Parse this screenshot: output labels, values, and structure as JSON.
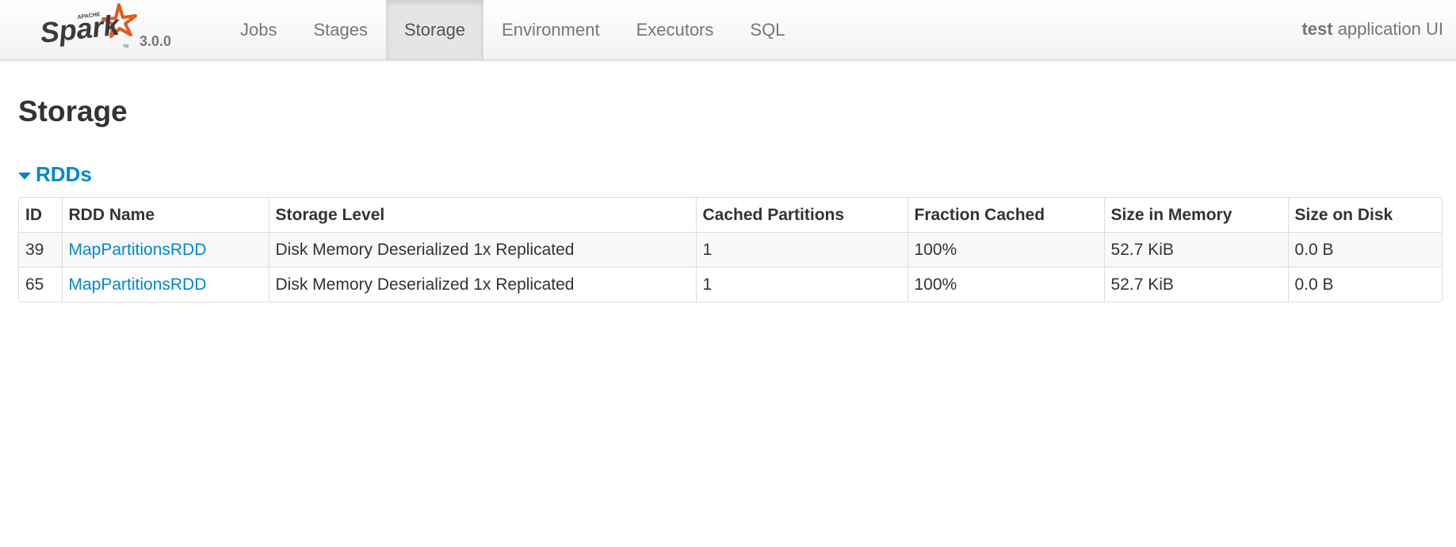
{
  "app": {
    "version": "3.0.0",
    "app_name_bold": "test",
    "app_name_rest": " application UI"
  },
  "nav": {
    "items": [
      {
        "label": "Jobs",
        "active": false
      },
      {
        "label": "Stages",
        "active": false
      },
      {
        "label": "Storage",
        "active": true
      },
      {
        "label": "Environment",
        "active": false
      },
      {
        "label": "Executors",
        "active": false
      },
      {
        "label": "SQL",
        "active": false
      }
    ]
  },
  "page": {
    "title": "Storage"
  },
  "rdds": {
    "section_label": "RDDs",
    "columns": [
      "ID",
      "RDD Name",
      "Storage Level",
      "Cached Partitions",
      "Fraction Cached",
      "Size in Memory",
      "Size on Disk"
    ],
    "rows": [
      {
        "id": "39",
        "name": "MapPartitionsRDD",
        "storage_level": "Disk Memory Deserialized 1x Replicated",
        "cached_partitions": "1",
        "fraction_cached": "100%",
        "size_in_memory": "52.7 KiB",
        "size_on_disk": "0.0 B"
      },
      {
        "id": "65",
        "name": "MapPartitionsRDD",
        "storage_level": "Disk Memory Deserialized 1x Replicated",
        "cached_partitions": "1",
        "fraction_cached": "100%",
        "size_in_memory": "52.7 KiB",
        "size_on_disk": "0.0 B"
      }
    ]
  },
  "colors": {
    "link": "#0088cc",
    "spark_orange": "#e25a1c",
    "spark_text": "#3c3a3e"
  },
  "icons": {
    "logo": "spark-logo",
    "collapse": "triangle-down-icon"
  }
}
